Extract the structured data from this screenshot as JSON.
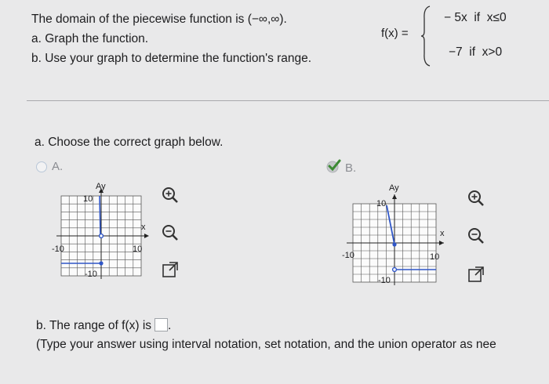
{
  "question": {
    "intro": "The domain of the piecewise function is (−∞,∞).",
    "part_a": "a. Graph the function.",
    "part_b": "b. Use your graph to determine the function's range."
  },
  "function": {
    "lhs": "f(x) =",
    "piece1": "− 5x  if  x≤0",
    "piece2": "−7  if  x>0"
  },
  "prompt_a": "a. Choose the correct graph below.",
  "options": [
    {
      "label": "A.",
      "selected": false
    },
    {
      "label": "B.",
      "selected": true
    }
  ],
  "graph_labels": {
    "y": "Ay",
    "x": "x",
    "neg10": "-10",
    "pos10": "10",
    "top10": "10",
    "bottom": "-10"
  },
  "part_b": {
    "text": "b. The range of f(x) is",
    "answer_value": "",
    "end": ".",
    "instructions": "(Type your answer using interval notation, set notation, and the union operator as nee"
  },
  "icons": [
    "zoom-in-icon",
    "zoom-out-icon",
    "expand-icon",
    "checkmark-icon"
  ],
  "colors": {
    "accent": "#2f56c8",
    "check": "#3c8a34",
    "line": "#2f56c8"
  }
}
